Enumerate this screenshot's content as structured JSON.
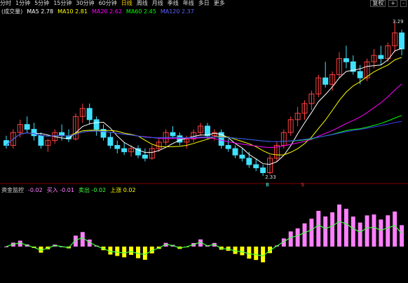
{
  "toolbar": {
    "items": [
      "分时",
      "1分钟",
      "5分钟",
      "15分钟",
      "30分钟",
      "60分钟",
      "日线",
      "周线",
      "月线",
      "季线",
      "年线",
      "多日",
      "更多"
    ],
    "active_index": 6,
    "right_buttons": [
      "复权",
      "+",
      "-"
    ]
  },
  "main_legend": {
    "title": "(成交量)",
    "ma5": "MA5 2.78",
    "ma10": "MA10 2.81",
    "ma20": "MA20 2.62",
    "ma60": "MA60 2.45",
    "ma120": "MA120 2.37"
  },
  "sub_legend": {
    "title": "资金监控",
    "v1": "-0.02",
    "v2": "买入 -0.01",
    "v3": "卖出 -0.02",
    "v4": "上涨 0.02"
  },
  "annotations": {
    "high_price": "3.29",
    "low_price": "2.33",
    "buy_marker": "B",
    "sell_marker": "S"
  },
  "colors": {
    "up": "#ff4040",
    "down": "#40e0ff",
    "ma5": "#ffffff",
    "ma10": "#ffff00",
    "ma20": "#ff00ff",
    "ma60": "#00ff00",
    "ma120": "#4040ff",
    "hist_pos": "#ff80ff",
    "hist_neg": "#ffff00",
    "line_green": "#40ff40"
  },
  "chart_data": {
    "type": "candlestick",
    "ohlc": [
      [
        2.55,
        2.58,
        2.5,
        2.52
      ],
      [
        2.52,
        2.62,
        2.5,
        2.6
      ],
      [
        2.6,
        2.68,
        2.57,
        2.65
      ],
      [
        2.65,
        2.7,
        2.6,
        2.62
      ],
      [
        2.62,
        2.66,
        2.55,
        2.58
      ],
      [
        2.58,
        2.6,
        2.5,
        2.52
      ],
      [
        2.52,
        2.56,
        2.48,
        2.55
      ],
      [
        2.55,
        2.62,
        2.53,
        2.6
      ],
      [
        2.6,
        2.65,
        2.55,
        2.58
      ],
      [
        2.58,
        2.62,
        2.54,
        2.56
      ],
      [
        2.56,
        2.72,
        2.55,
        2.7
      ],
      [
        2.7,
        2.78,
        2.66,
        2.75
      ],
      [
        2.75,
        2.78,
        2.65,
        2.68
      ],
      [
        2.68,
        2.7,
        2.58,
        2.62
      ],
      [
        2.62,
        2.65,
        2.55,
        2.57
      ],
      [
        2.57,
        2.6,
        2.5,
        2.52
      ],
      [
        2.52,
        2.55,
        2.47,
        2.5
      ],
      [
        2.5,
        2.54,
        2.46,
        2.48
      ],
      [
        2.48,
        2.52,
        2.45,
        2.5
      ],
      [
        2.5,
        2.52,
        2.44,
        2.46
      ],
      [
        2.46,
        2.5,
        2.42,
        2.44
      ],
      [
        2.44,
        2.52,
        2.43,
        2.5
      ],
      [
        2.5,
        2.56,
        2.48,
        2.54
      ],
      [
        2.54,
        2.62,
        2.52,
        2.6
      ],
      [
        2.6,
        2.64,
        2.56,
        2.58
      ],
      [
        2.58,
        2.6,
        2.52,
        2.54
      ],
      [
        2.54,
        2.58,
        2.5,
        2.56
      ],
      [
        2.56,
        2.62,
        2.54,
        2.6
      ],
      [
        2.6,
        2.66,
        2.58,
        2.64
      ],
      [
        2.64,
        2.66,
        2.56,
        2.58
      ],
      [
        2.58,
        2.62,
        2.55,
        2.6
      ],
      [
        2.6,
        2.62,
        2.5,
        2.52
      ],
      [
        2.52,
        2.56,
        2.48,
        2.5
      ],
      [
        2.5,
        2.52,
        2.44,
        2.46
      ],
      [
        2.46,
        2.5,
        2.42,
        2.44
      ],
      [
        2.44,
        2.48,
        2.38,
        2.4
      ],
      [
        2.4,
        2.44,
        2.36,
        2.38
      ],
      [
        2.38,
        2.4,
        2.33,
        2.35
      ],
      [
        2.35,
        2.46,
        2.34,
        2.44
      ],
      [
        2.44,
        2.54,
        2.42,
        2.52
      ],
      [
        2.52,
        2.62,
        2.5,
        2.6
      ],
      [
        2.6,
        2.7,
        2.58,
        2.68
      ],
      [
        2.68,
        2.76,
        2.64,
        2.72
      ],
      [
        2.72,
        2.8,
        2.68,
        2.78
      ],
      [
        2.78,
        2.86,
        2.74,
        2.84
      ],
      [
        2.84,
        2.96,
        2.82,
        2.94
      ],
      [
        2.94,
        3.04,
        2.88,
        2.9
      ],
      [
        2.9,
        2.98,
        2.86,
        2.96
      ],
      [
        2.96,
        3.1,
        2.94,
        3.06
      ],
      [
        3.06,
        3.14,
        3.0,
        3.04
      ],
      [
        3.04,
        3.08,
        2.96,
        2.98
      ],
      [
        2.98,
        3.02,
        2.9,
        2.94
      ],
      [
        2.94,
        3.06,
        2.92,
        3.04
      ],
      [
        3.04,
        3.12,
        3.0,
        3.08
      ],
      [
        3.08,
        3.14,
        3.02,
        3.06
      ],
      [
        3.06,
        3.16,
        3.04,
        3.14
      ],
      [
        3.14,
        3.29,
        3.1,
        3.22
      ],
      [
        3.22,
        3.24,
        3.08,
        3.12
      ]
    ],
    "ylim": [
      2.3,
      3.32
    ]
  }
}
